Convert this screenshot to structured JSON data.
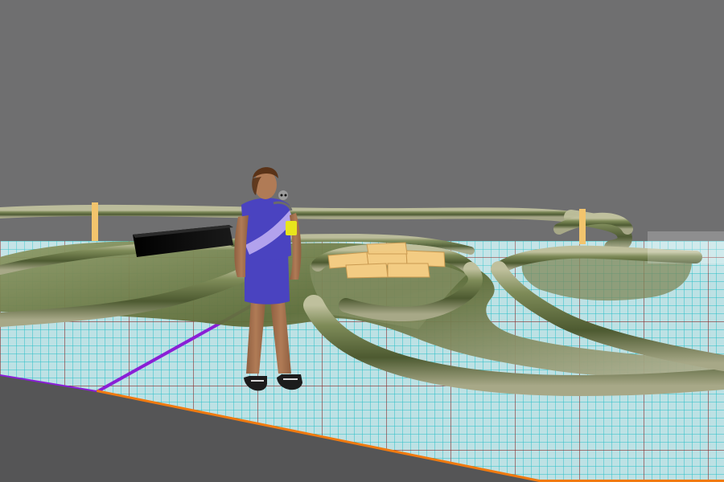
{
  "scene": {
    "description_text": "",
    "sky_color": "#6f6f70",
    "ground_color": "#555556",
    "grid": {
      "fill_color": "#bfe3e6",
      "minor_line_color": "#27c2c9",
      "major_line_color": "#8a2b2b",
      "edge_color_left": "#8a1fd6",
      "edge_color_front": "#f07a10"
    },
    "track": {
      "wall_color": "#5a6a3a",
      "wall_highlight": "#a7a887",
      "floor_color": "#7f8a5a"
    },
    "props": {
      "black_box_color": "#050505",
      "posts_color": "#f2c46d",
      "crates_color": "#f3cc83"
    },
    "avatar": {
      "shirt_color": "#4a43c0",
      "sash_color": "#b7a8ef",
      "shorts_color": "#4a43c0",
      "skin_color": "#b07b56",
      "hair_color": "#5a3318",
      "armband_color": "#e8e51c",
      "shoes_color": "#1c1c1c"
    }
  }
}
